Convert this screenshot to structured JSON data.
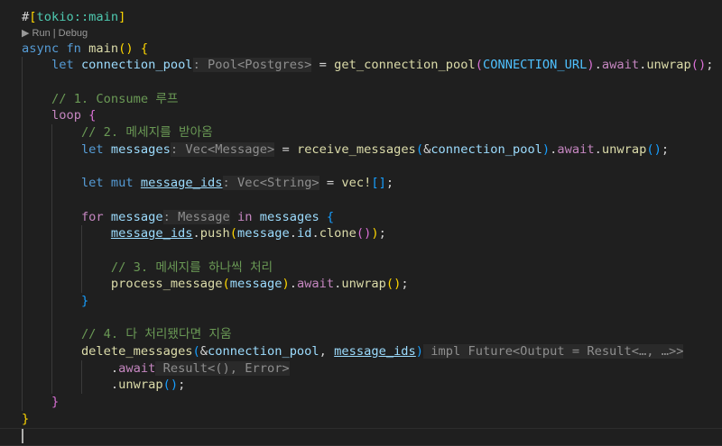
{
  "codelens": "▶ Run | Debug",
  "lines": [
    {
      "indent": 0,
      "t": [
        [
          "#",
          ""
        ],
        [
          "[",
          "b1"
        ],
        [
          "tokio::main",
          "type"
        ],
        [
          "]",
          "b1"
        ]
      ]
    },
    {
      "lens": true
    },
    {
      "indent": 0,
      "t": [
        [
          "async",
          "kw"
        ],
        [
          " fn",
          "kw"
        ],
        [
          " main",
          "fn"
        ],
        [
          "()",
          "b1"
        ],
        [
          " {",
          "b1"
        ]
      ]
    },
    {
      "indent": 1,
      "t": [
        [
          "let",
          "kw"
        ],
        [
          " connection_pool",
          "var"
        ],
        [
          ": Pool<Postgres>",
          "hint"
        ],
        [
          " = ",
          ""
        ],
        [
          "get_connection_pool",
          "fn"
        ],
        [
          "(",
          "b2"
        ],
        [
          "CONNECTION_URL",
          "const"
        ],
        [
          ")",
          "b2"
        ],
        [
          ".",
          ""
        ],
        [
          "await",
          "ctrl"
        ],
        [
          ".",
          ""
        ],
        [
          "unwrap",
          "fn"
        ],
        [
          "()",
          "b2"
        ],
        [
          ";",
          ""
        ]
      ]
    },
    {
      "indent": 1,
      "t": []
    },
    {
      "indent": 1,
      "t": [
        [
          "// 1. Consume 루프",
          "cm"
        ]
      ]
    },
    {
      "indent": 1,
      "t": [
        [
          "loop",
          "ctrl"
        ],
        [
          " {",
          "b2"
        ]
      ]
    },
    {
      "indent": 2,
      "t": [
        [
          "// 2. 메세지를 받아옴",
          "cm"
        ]
      ]
    },
    {
      "indent": 2,
      "t": [
        [
          "let",
          "kw"
        ],
        [
          " messages",
          "var"
        ],
        [
          ": Vec<Message>",
          "hint"
        ],
        [
          " = ",
          ""
        ],
        [
          "receive_messages",
          "fn"
        ],
        [
          "(",
          "b3"
        ],
        [
          "&",
          ""
        ],
        [
          "connection_pool",
          "var"
        ],
        [
          ")",
          "b3"
        ],
        [
          ".",
          ""
        ],
        [
          "await",
          "ctrl"
        ],
        [
          ".",
          ""
        ],
        [
          "unwrap",
          "fn"
        ],
        [
          "()",
          "b3"
        ],
        [
          ";",
          ""
        ]
      ]
    },
    {
      "indent": 2,
      "t": []
    },
    {
      "indent": 2,
      "t": [
        [
          "let",
          "kw"
        ],
        [
          " mut",
          "kw"
        ],
        [
          " ",
          ""
        ],
        [
          "message_ids",
          "var ul"
        ],
        [
          ": Vec<String>",
          "hint"
        ],
        [
          " = ",
          ""
        ],
        [
          "vec!",
          "fn"
        ],
        [
          "[]",
          "b3"
        ],
        [
          ";",
          ""
        ]
      ]
    },
    {
      "indent": 2,
      "t": []
    },
    {
      "indent": 2,
      "t": [
        [
          "for",
          "ctrl"
        ],
        [
          " message",
          "var"
        ],
        [
          ": Message",
          "hint"
        ],
        [
          " in",
          "ctrl"
        ],
        [
          " messages",
          "var"
        ],
        [
          " {",
          "b3"
        ]
      ]
    },
    {
      "indent": 3,
      "t": [
        [
          "message_ids",
          "var ul"
        ],
        [
          ".",
          ""
        ],
        [
          "push",
          "fn"
        ],
        [
          "(",
          "b1"
        ],
        [
          "message",
          "var"
        ],
        [
          ".",
          ""
        ],
        [
          "id",
          "var"
        ],
        [
          ".",
          ""
        ],
        [
          "clone",
          "fn"
        ],
        [
          "()",
          "b2"
        ],
        [
          ")",
          "b1"
        ],
        [
          ";",
          ""
        ]
      ]
    },
    {
      "indent": 3,
      "t": []
    },
    {
      "indent": 3,
      "t": [
        [
          "// 3. 메세지를 하나씩 처리",
          "cm"
        ]
      ]
    },
    {
      "indent": 3,
      "t": [
        [
          "process_message",
          "fn"
        ],
        [
          "(",
          "b1"
        ],
        [
          "message",
          "var"
        ],
        [
          ")",
          "b1"
        ],
        [
          ".",
          ""
        ],
        [
          "await",
          "ctrl"
        ],
        [
          ".",
          ""
        ],
        [
          "unwrap",
          "fn"
        ],
        [
          "()",
          "b1"
        ],
        [
          ";",
          ""
        ]
      ]
    },
    {
      "indent": 2,
      "t": [
        [
          "}",
          "b3"
        ]
      ]
    },
    {
      "indent": 2,
      "t": []
    },
    {
      "indent": 2,
      "t": [
        [
          "// 4. 다 처리됐다면 지움",
          "cm"
        ]
      ]
    },
    {
      "indent": 2,
      "t": [
        [
          "delete_messages",
          "fn"
        ],
        [
          "(",
          "b3"
        ],
        [
          "&",
          ""
        ],
        [
          "connection_pool",
          "var"
        ],
        [
          ", ",
          ""
        ],
        [
          "message_ids",
          "var ul"
        ],
        [
          ")",
          "b3"
        ],
        [
          " impl Future<Output = Result<…, …>>",
          "hint"
        ]
      ]
    },
    {
      "indent": 3,
      "t": [
        [
          ".",
          ""
        ],
        [
          "await",
          "ctrl"
        ],
        [
          " Result<(), Error>",
          "hint"
        ]
      ]
    },
    {
      "indent": 3,
      "t": [
        [
          ".",
          ""
        ],
        [
          "unwrap",
          "fn"
        ],
        [
          "()",
          "b3"
        ],
        [
          ";",
          ""
        ]
      ]
    },
    {
      "indent": 1,
      "t": [
        [
          "}",
          "b2"
        ]
      ]
    },
    {
      "indent": 0,
      "t": [
        [
          "}",
          "b1"
        ]
      ]
    },
    {
      "indent": 0,
      "t": [],
      "current": true
    }
  ]
}
